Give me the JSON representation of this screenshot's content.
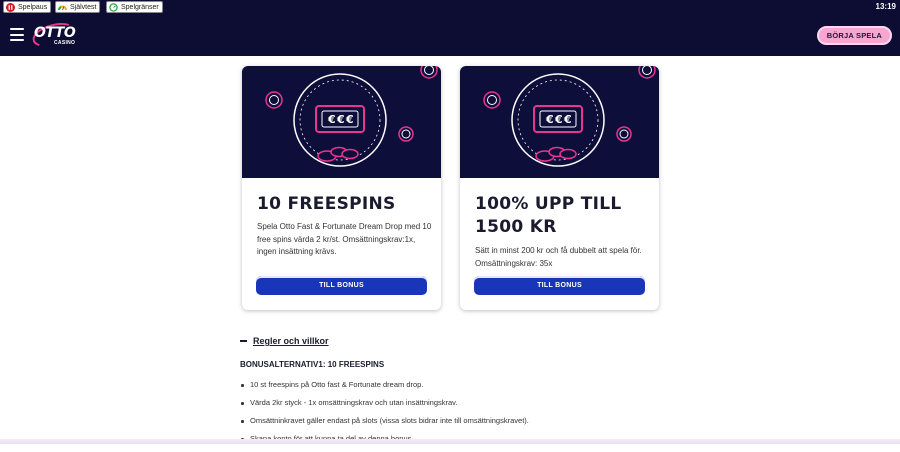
{
  "spelpaus_bar": {
    "buttons": [
      {
        "label": "Spelpaus",
        "icon": "spelpaus-icon"
      },
      {
        "label": "Självtest",
        "icon": "sjalvtest-icon"
      },
      {
        "label": "Spelgränser",
        "icon": "spelgranser-icon"
      }
    ],
    "clock": "13:19"
  },
  "header": {
    "logo_text": "OTTO",
    "logo_sub": "CASINO",
    "cta_label": "BÖRJA SPELA"
  },
  "offers": [
    {
      "title": "10 FREESPINS",
      "text": "Spela Otto Fast & Fortunate Dream Drop med 10 free spins värda 2 kr/st. Omsättningskrav:1x, ingen insättning krävs.",
      "button": "TILL BONUS"
    },
    {
      "title": "100% UPP TILL 1500 KR",
      "text": "Sätt in minst 200 kr och få dubbelt att spela för. Omsättningskrav: 35x",
      "button": "TILL BONUS"
    }
  ],
  "terms": {
    "heading": "Regler och villkor",
    "subheading": "BONUSALTERNATIV1: 10 FREESPINS",
    "items": [
      "10 st freespins på Otto fast & Fortunate dream drop.",
      "Värda 2kr styck - 1x omsättningskrav och utan insättningskrav.",
      "Omsättninkravet gäller endast på slots (vissa slots bidrar inte till omsättningskravet).",
      "Skapa konto för att kunna ta del av denna bonus"
    ]
  },
  "colors": {
    "navy": "#0d0d33",
    "pink": "#e8358f",
    "cta_bg": "#f7a6d2",
    "button_blue": "#1a36b8"
  }
}
